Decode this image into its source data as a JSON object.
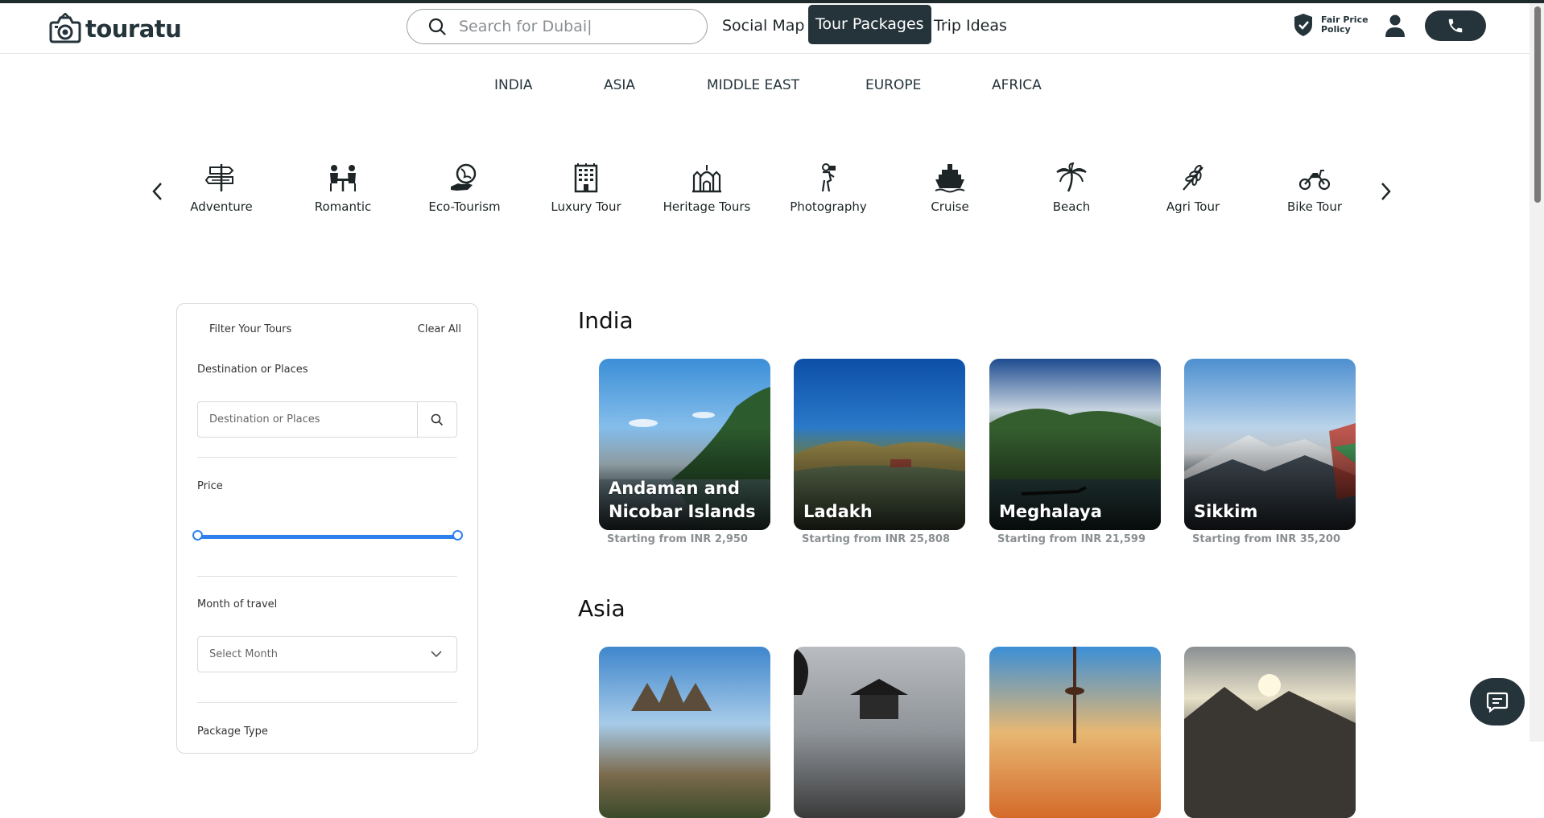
{
  "brand": {
    "logo_text": "touratu"
  },
  "header": {
    "search_placeholder": "Search for Dubai|",
    "nav": {
      "social_map": "Social Map",
      "tour_packages": "Tour Packages",
      "trip_ideas": "Trip Ideas"
    },
    "fair_price_line1": "Fair Price",
    "fair_price_line2": "Policy"
  },
  "regions": [
    "INDIA",
    "ASIA",
    "MIDDLE EAST",
    "EUROPE",
    "AFRICA"
  ],
  "categories": [
    "Adventure",
    "Romantic",
    "Eco-Tourism",
    "Luxury Tour",
    "Heritage Tours",
    "Photography",
    "Cruise",
    "Beach",
    "Agri Tour",
    "Bike Tour"
  ],
  "filter": {
    "title": "Filter Your Tours",
    "clear": "Clear All",
    "destination_label": "Destination or Places",
    "destination_placeholder": "Destination or Places",
    "price_label": "Price",
    "price_range": {
      "min_fraction": 0,
      "max_fraction": 1
    },
    "month_label": "Month of travel",
    "month_placeholder": "Select Month",
    "package_type_label": "Package Type"
  },
  "sections": {
    "india": {
      "title": "India",
      "cards": [
        {
          "name": "Andaman and Nicobar Islands",
          "price": "Starting from INR 2,950"
        },
        {
          "name": "Ladakh",
          "price": "Starting from INR 25,808"
        },
        {
          "name": "Meghalaya",
          "price": "Starting from INR 21,599"
        },
        {
          "name": "Sikkim",
          "price": "Starting from INR 35,200"
        }
      ]
    },
    "asia": {
      "title": "Asia"
    }
  },
  "colors": {
    "dark": "#25343a",
    "accent_blue": "#2f80ed"
  }
}
